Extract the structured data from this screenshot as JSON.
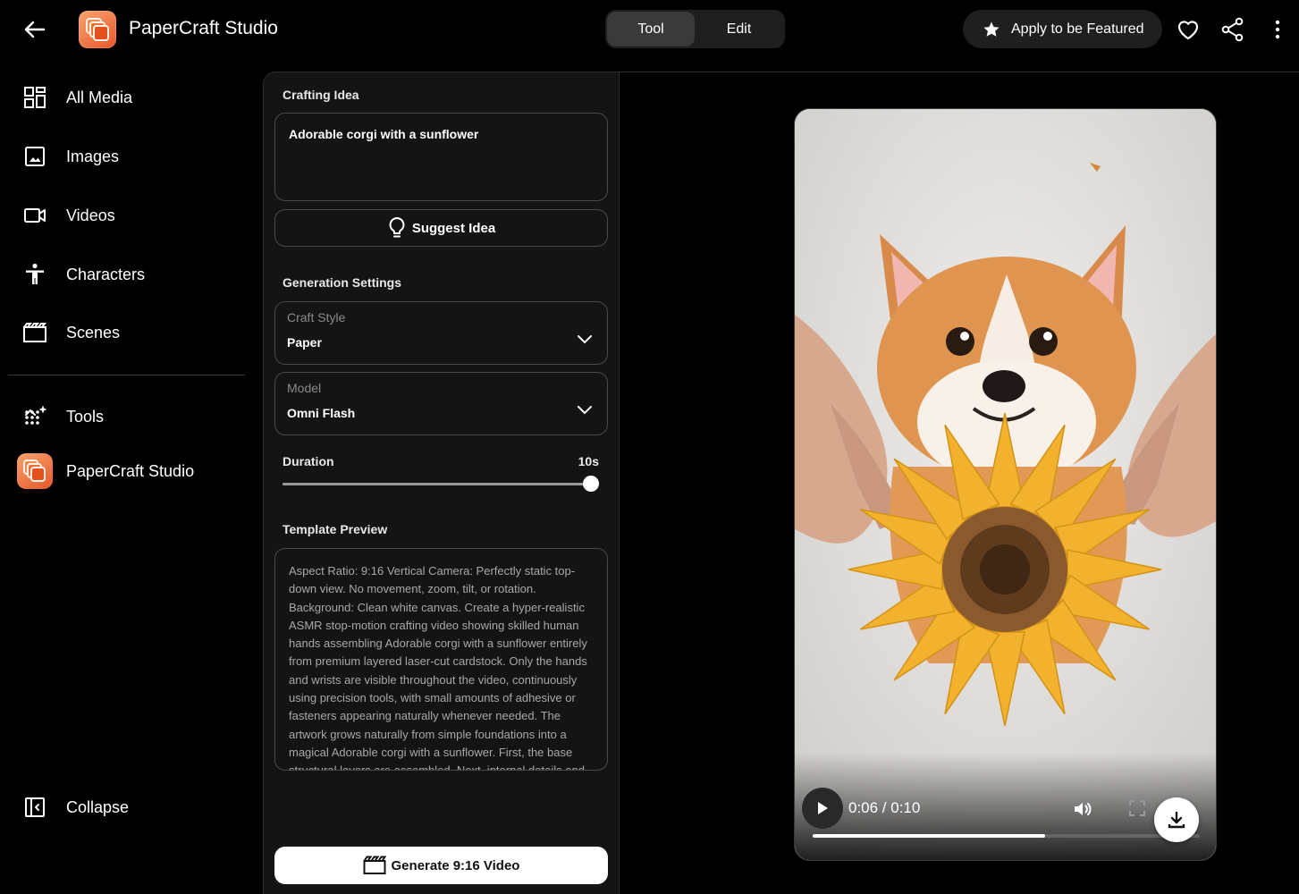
{
  "header": {
    "app_title": "PaperCraft Studio",
    "tabs": [
      {
        "label": "Tool",
        "active": true
      },
      {
        "label": "Edit",
        "active": false
      }
    ],
    "featured_label": "Apply to be Featured"
  },
  "sidebar": {
    "items": [
      {
        "label": "All Media",
        "icon": "grid-icon"
      },
      {
        "label": "Images",
        "icon": "image-icon"
      },
      {
        "label": "Videos",
        "icon": "video-camera-icon"
      },
      {
        "label": "Characters",
        "icon": "person-icon"
      },
      {
        "label": "Scenes",
        "icon": "clapperboard-icon"
      }
    ],
    "tools_label": "Tools",
    "tool_item": "PaperCraft Studio",
    "collapse_label": "Collapse"
  },
  "panel": {
    "crafting_idea_label": "Crafting Idea",
    "crafting_idea_value": "Adorable corgi with a sunflower",
    "suggest_label": "Suggest Idea",
    "generation_settings_label": "Generation Settings",
    "craft_style": {
      "caption": "Craft Style",
      "value": "Paper"
    },
    "model": {
      "caption": "Model",
      "value": "Omni Flash"
    },
    "duration": {
      "label": "Duration",
      "value_label": "10s",
      "fraction": 1.0
    },
    "template_preview_label": "Template Preview",
    "template_preview_text": "Aspect Ratio: 9:16 Vertical Camera: Perfectly static top-down view. No movement, zoom, tilt, or rotation. Background: Clean white canvas. Create a hyper-realistic ASMR stop-motion crafting video showing skilled human hands assembling Adorable corgi with a sunflower entirely from premium layered laser-cut cardstock. Only the hands and wrists are visible throughout the video, continuously using precision tools, with small amounts of adhesive or fasteners appearing naturally whenever needed. The artwork grows naturally from simple foundations into a magical Adorable corgi with a sunflower. First, the base structural layers are assembled. Next, internal details and",
    "generate_label": "Generate 9:16 Video"
  },
  "video": {
    "time_label": "0:06 / 0:10",
    "progress": 0.6
  },
  "colors": {
    "accent_orange": "#e8572a",
    "background": "#000000",
    "panel": "#141414"
  }
}
